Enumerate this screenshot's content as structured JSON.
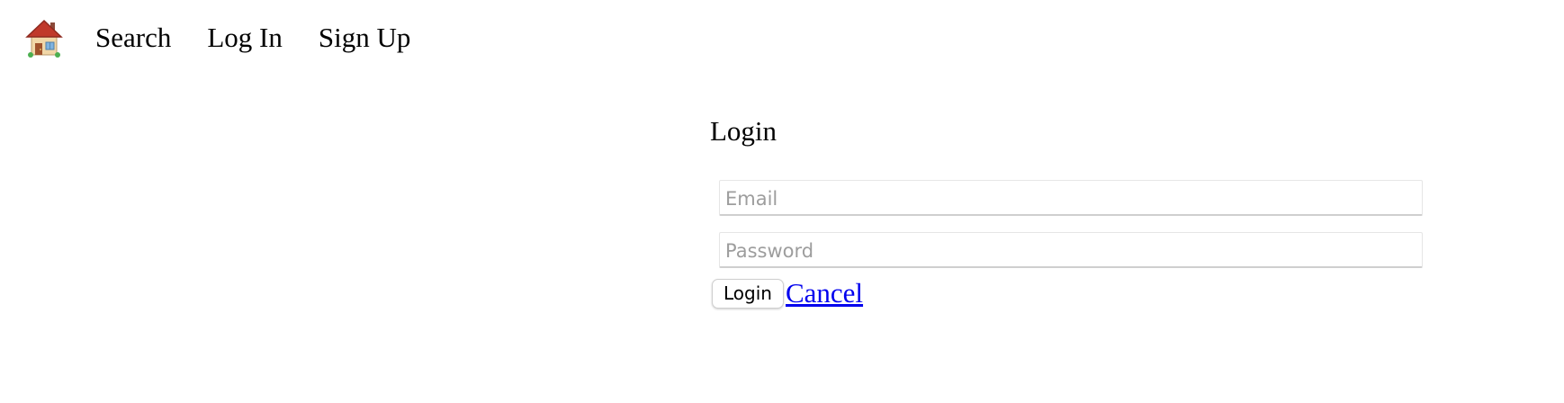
{
  "nav": {
    "home_icon": "house-icon",
    "links": [
      {
        "label": "Search"
      },
      {
        "label": "Log In"
      },
      {
        "label": "Sign Up"
      }
    ]
  },
  "login": {
    "title": "Login",
    "email": {
      "placeholder": "Email",
      "value": ""
    },
    "password": {
      "placeholder": "Password",
      "value": ""
    },
    "submit_label": "Login",
    "cancel_label": "Cancel"
  },
  "colors": {
    "link": "#0000ee",
    "text": "#000000",
    "placeholder": "#9d9d9d",
    "background": "#ffffff"
  }
}
